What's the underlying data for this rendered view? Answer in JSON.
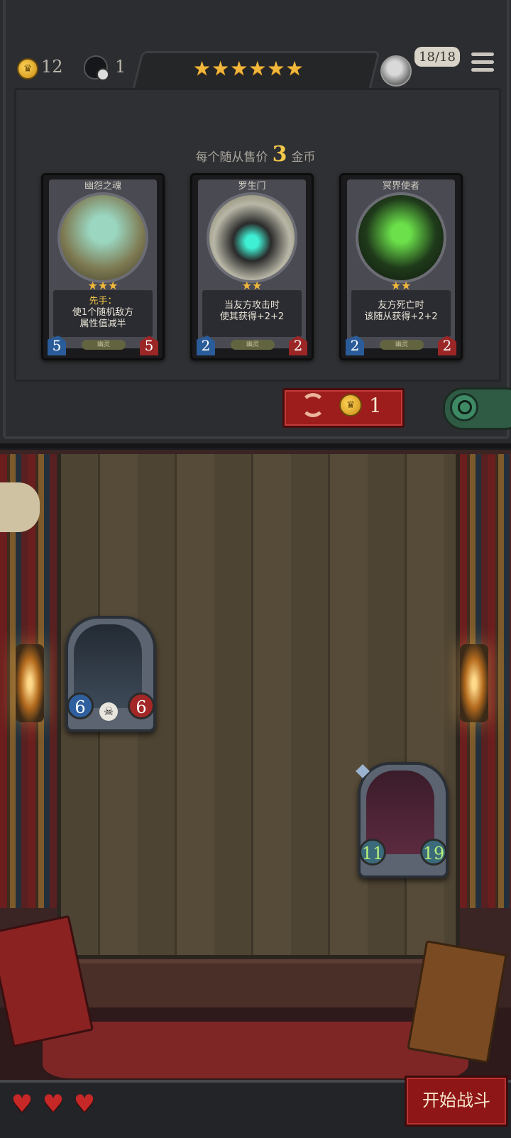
{
  "hud": {
    "gold": "12",
    "timer_count": "1",
    "stars": "★★★★★★",
    "health": "18/18",
    "icons": [
      "coin-icon",
      "cat-clock-icon",
      "player-avatar-icon",
      "menu-icon"
    ]
  },
  "shop": {
    "price_prefix": "每个随从售价",
    "price_value": "3",
    "price_suffix": "金币",
    "cards": [
      {
        "name": "幽怨之魂",
        "stars": "★★★",
        "keyword": "先手：",
        "description_line1": "使1个随机敌方",
        "description_line2": "属性值减半",
        "tribe": "幽灵",
        "attack": "5",
        "health": "5",
        "art_color": "#8d8a5e"
      },
      {
        "name": "罗生门",
        "stars": "★★",
        "keyword": "",
        "description_line1": "当友方攻击时",
        "description_line2": "使其获得+2+2",
        "tribe": "幽灵",
        "attack": "2",
        "health": "2",
        "art_color": "#6f6d4b"
      },
      {
        "name": "冥界使者",
        "stars": "★★",
        "keyword": "",
        "description_line1": "友方死亡时",
        "description_line2": "该随从获得+2+2",
        "tribe": "幽灵",
        "attack": "2",
        "health": "2",
        "art_color": "#2f6a2b"
      }
    ],
    "refresh_cost": "1"
  },
  "board": {
    "minions": [
      {
        "attack": "6",
        "health": "6"
      },
      {
        "attack": "11",
        "health": "19"
      }
    ],
    "skull": "☠"
  },
  "player": {
    "lives": [
      "♥",
      "♥",
      "♥"
    ]
  },
  "actions": {
    "start_battle": "开始战斗"
  }
}
